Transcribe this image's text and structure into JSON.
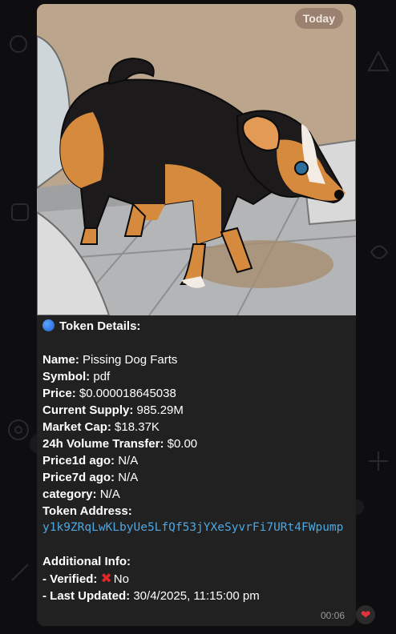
{
  "date_pill": "Today",
  "image": {
    "alt": "cartoon dog"
  },
  "caption": {
    "header": "Token Details:",
    "name_label": "Name:",
    "name_value": "Pissing Dog Farts",
    "symbol_label": "Symbol:",
    "symbol_value": "pdf",
    "price_label": "Price:",
    "price_value": "$0.000018645038",
    "supply_label": "Current Supply:",
    "supply_value": "985.29M",
    "mcap_label": "Market Cap:",
    "mcap_value": "$18.37K",
    "volume_label": "24h Volume Transfer:",
    "volume_value": "$0.00",
    "price1d_label": "Price1d ago:",
    "price1d_value": "N/A",
    "price7d_label": "Price7d ago:",
    "price7d_value": "N/A",
    "category_label": "category:",
    "category_value": "N/A",
    "address_label": "Token Address:",
    "address_value": "y1k9ZRqLwKLbyUe5LfQf53jYXeSyvrFi7URt4FWpump",
    "additional_label": "Additional Info:",
    "verified_label": "- Verified:",
    "verified_value": "No",
    "updated_label": "- Last Updated:",
    "updated_value": "30/4/2025, 11:15:00 pm"
  },
  "meta": {
    "time": "00:06"
  },
  "colors": {
    "bubble": "#212121",
    "link": "#4ea6e0",
    "x_mark": "#e0262a"
  }
}
